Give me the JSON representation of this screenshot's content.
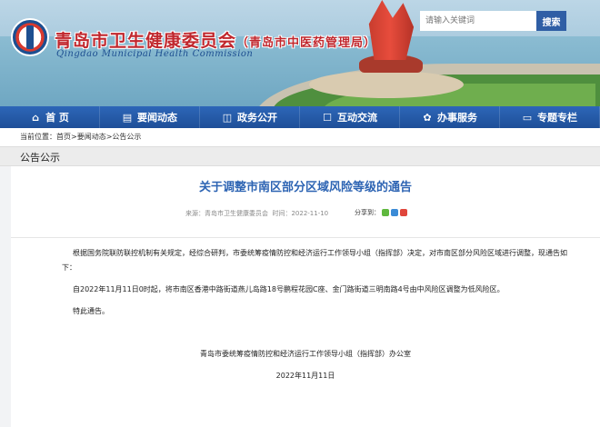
{
  "header": {
    "site_title": "青岛市卫生健康委员会",
    "site_subtitle": "（青岛市中医药管理局）",
    "site_title_en": "Qingdao Municipal Health Commission",
    "search_placeholder": "请输入关键词",
    "search_button": "搜索"
  },
  "nav": {
    "items": [
      {
        "label": "首 页",
        "icon": "home-icon"
      },
      {
        "label": "要闻动态",
        "icon": "news-icon"
      },
      {
        "label": "政务公开",
        "icon": "gov-icon"
      },
      {
        "label": "互动交流",
        "icon": "chat-icon"
      },
      {
        "label": "办事服务",
        "icon": "service-icon"
      },
      {
        "label": "专题专栏",
        "icon": "topic-icon"
      }
    ]
  },
  "breadcrumb": {
    "prefix": "当前位置：",
    "items": [
      "首页",
      "要闻动态",
      "公告公示"
    ],
    "separator": ">"
  },
  "section": {
    "title": "公告公示"
  },
  "article": {
    "title": "关于调整市南区部分区域风险等级的通告",
    "source_label": "来源：",
    "source": "青岛市卫生健康委员会",
    "time_label": "时间：",
    "time": "2022-11-10",
    "share_label": "分享到：",
    "paragraphs": [
      "根据国务院联防联控机制有关规定，经综合研判，市委统筹疫情防控和经济运行工作领导小组（指挥部）决定，对市南区部分风险区域进行调整，现通告如下：",
      "自2022年11月11日0时起，将市南区香港中路街道燕儿岛路18号鹏程花园C座、金门路街道三明南路4号由中风险区调整为低风险区。",
      "特此通告。"
    ],
    "signature": "青岛市委统筹疫情防控和经济运行工作领导小组（指挥部）办公室",
    "date": "2022年11月11日"
  },
  "colors": {
    "nav_bg": "#1e4f98",
    "title_red": "#c1272d",
    "article_title_blue": "#2d64b3"
  }
}
